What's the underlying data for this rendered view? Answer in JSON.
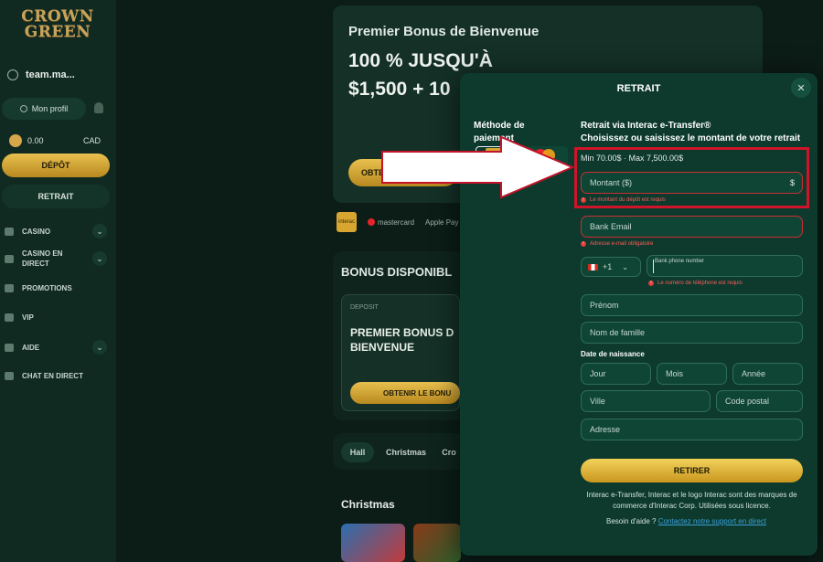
{
  "sidebar": {
    "logo_line1": "CROWN",
    "logo_line2": "GREEN",
    "username": "team.ma...",
    "profile_label": "Mon profil",
    "balance": "0.00",
    "currency": "CAD",
    "depot_label": "DÉPÔT",
    "retrait_label": "RETRAIT",
    "nav": [
      {
        "label": "CASINO",
        "icon": "casino-icon",
        "has_chevron": true
      },
      {
        "label": "CASINO EN DIRECT",
        "icon": "live-casino-icon",
        "has_chevron": true
      },
      {
        "label": "PROMOTIONS",
        "icon": "gift-icon",
        "has_chevron": false
      },
      {
        "label": "VIP",
        "icon": "crown-icon",
        "has_chevron": false
      },
      {
        "label": "AIDE",
        "icon": "info-icon",
        "has_chevron": true
      },
      {
        "label": "CHAT EN DIRECT",
        "icon": "chat-icon",
        "has_chevron": false
      }
    ]
  },
  "background": {
    "promo_title": "Premier Bonus de Bienvenue",
    "promo_line1": "100 % JUSQU'À",
    "promo_line2": "$1,500 + 10",
    "promo_button": "OBTE",
    "payment_logos": [
      "interac",
      "mastercard",
      "Apple Pay"
    ],
    "bonus_title": "BONUS DISPONIBL",
    "bonus_card": {
      "tag": "DEPOSIT",
      "title": "PREMIER BONUS D BIENVENUE",
      "button": "OBTENIR LE BONU"
    },
    "tabs": [
      "Hall",
      "Christmas",
      "Cro"
    ],
    "section_title": "Christmas"
  },
  "modal": {
    "title": "RETRAIT",
    "method_label": "Méthode de paiement",
    "methods": [
      {
        "name": "Interac",
        "selected": true
      },
      {
        "name": "mastercard",
        "selected": false
      }
    ],
    "heading_line1": "Retrait via Interac e-Transfer®",
    "heading_line2": "Choisissez ou saisissez le montant de votre retrait",
    "limits": "Min 70.00$ · Max 7,500.00$",
    "amount": {
      "placeholder": "Montant ($)",
      "suffix": "$",
      "error": "Le montant du dépôt est requis"
    },
    "bank_email": {
      "placeholder": "Bank Email",
      "error": "Adresse e-mail obligatoire"
    },
    "phone": {
      "prefix": "+1",
      "placeholder": "Bank phone number",
      "error": "Le numéro de téléphone est requis"
    },
    "first_name": "Prénom",
    "last_name": "Nom de famille",
    "dob_label": "Date de naissance",
    "dob": {
      "day": "Jour",
      "month": "Mois",
      "year": "Année"
    },
    "city": "Ville",
    "postal_code": "Code postal",
    "address": "Adresse",
    "submit": "RETIRER",
    "legal": "Interac e-Transfer, Interac et le logo Interac sont des marques de commerce d'Interac Corp. Utilisées sous licence.",
    "help_prefix": "Besoin d'aide ?",
    "help_link": "Contactez notre support en direct"
  },
  "colors": {
    "accent_gold": "#d9ae3a",
    "modal_bg": "#0d3a2d",
    "error_red": "#cc2e33",
    "annotation_red": "#d0142a"
  }
}
